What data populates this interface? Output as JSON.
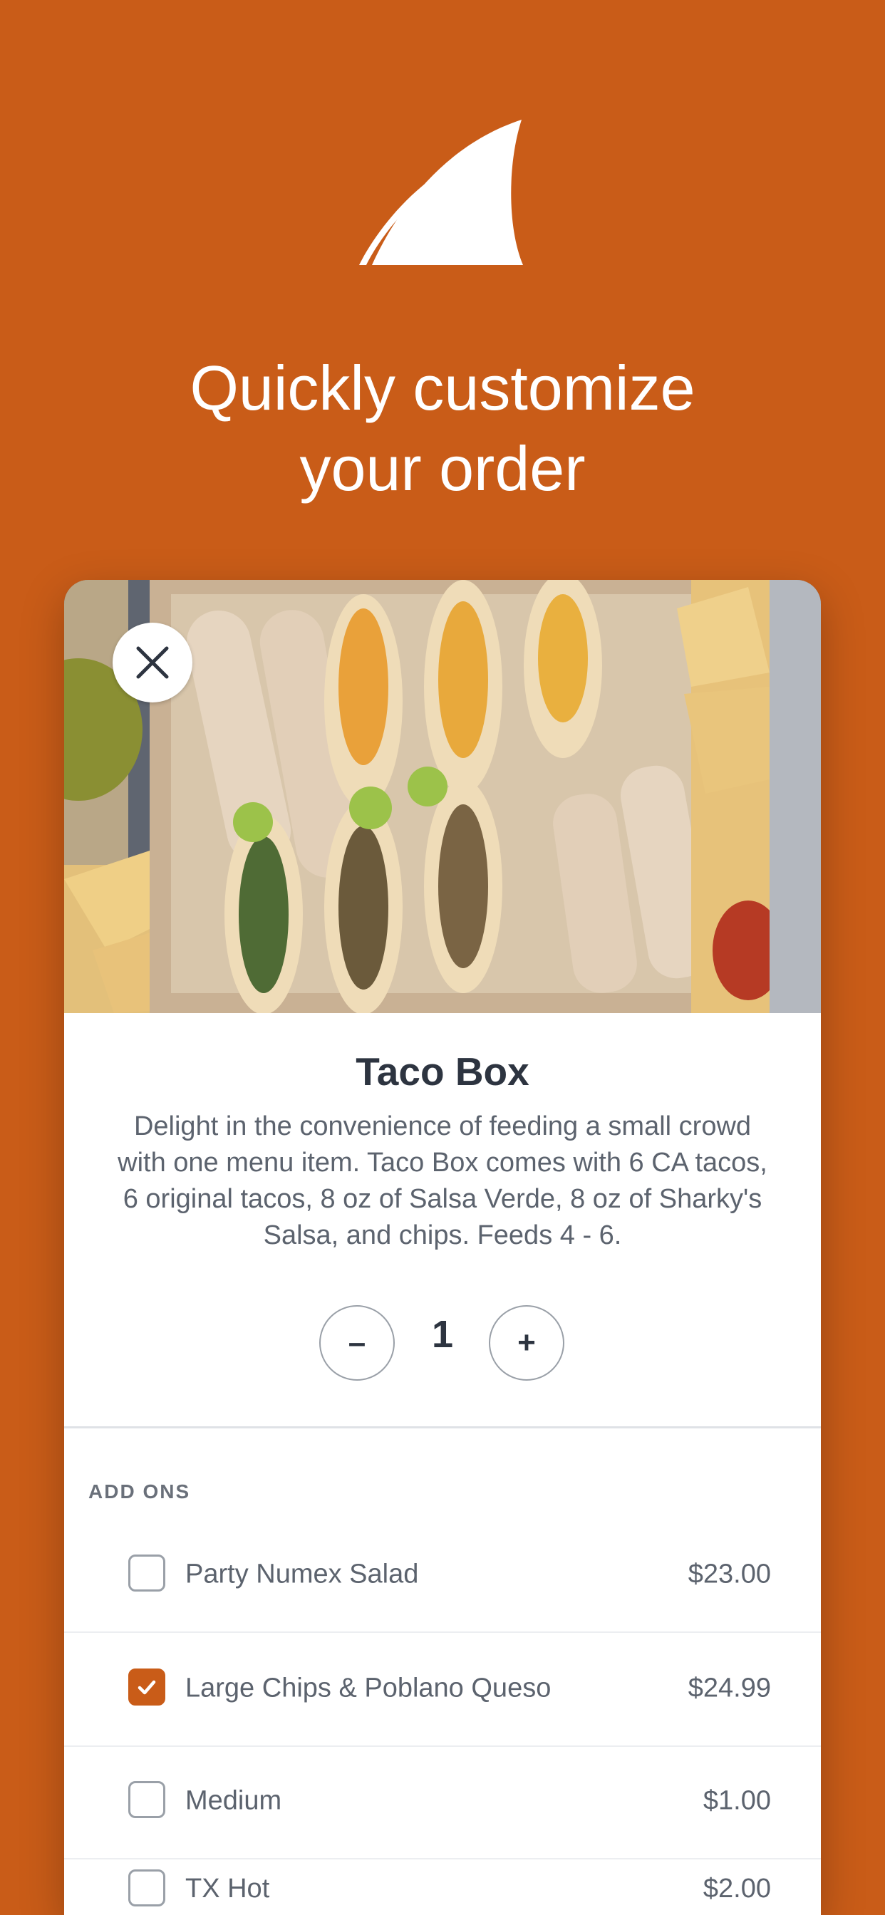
{
  "brand": {
    "accent_color": "#c95c18",
    "logo_icon": "shark-fin-icon"
  },
  "headline": {
    "line1": "Quickly customize",
    "line2": "your order"
  },
  "product": {
    "image_icon": "taco-box-photo",
    "close_icon": "close-icon",
    "title": "Taco Box",
    "description": "Delight in the convenience of feeding a small crowd with one menu item. Taco Box comes with 6 CA tacos, 6 original tacos, 8 oz of Salsa Verde, 8 oz of Sharky's Salsa, and chips. Feeds 4 - 6."
  },
  "quantity": {
    "minus_label": "–",
    "value": "1",
    "plus_label": "+"
  },
  "addons": {
    "section_label": "ADD ONS",
    "items": [
      {
        "name": "Party Numex Salad",
        "price": "$23.00",
        "checked": false
      },
      {
        "name": "Large Chips & Poblano Queso",
        "price": "$24.99",
        "checked": true
      },
      {
        "name": "Medium",
        "price": "$1.00",
        "checked": false
      },
      {
        "name": "TX Hot",
        "price": "$2.00",
        "checked": false
      }
    ]
  }
}
